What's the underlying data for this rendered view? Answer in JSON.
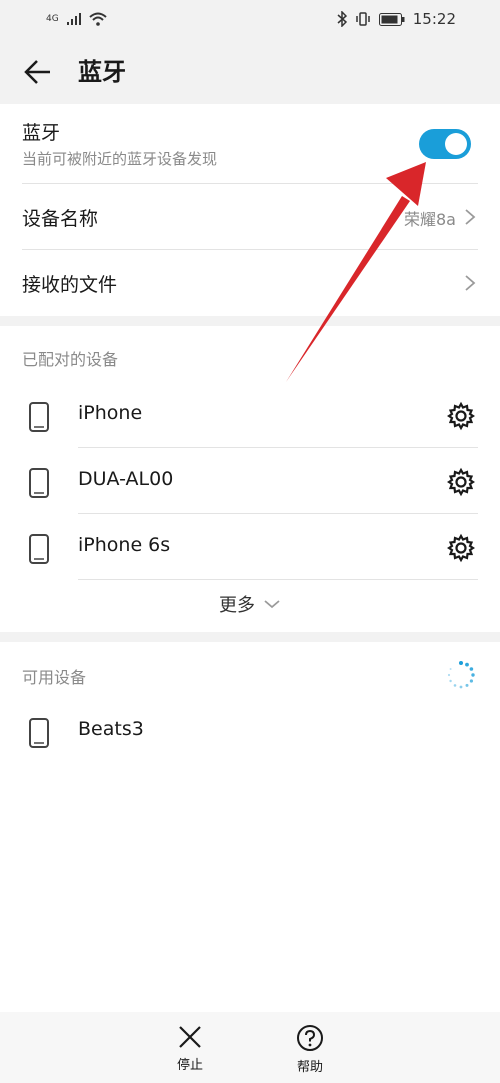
{
  "status_bar": {
    "network": "4G",
    "time": "15:22"
  },
  "app_bar": {
    "title": "蓝牙",
    "back_icon": "arrow-left-icon"
  },
  "bluetooth": {
    "title": "蓝牙",
    "subtitle": "当前可被附近的蓝牙设备发现",
    "enabled": true,
    "accent_color": "#1a9ed9"
  },
  "device_name": {
    "label": "设备名称",
    "value": "荣耀8a"
  },
  "received_files": {
    "label": "接收的文件"
  },
  "paired": {
    "header": "已配对的设备",
    "devices": [
      {
        "name": "iPhone"
      },
      {
        "name": "DUA-AL00"
      },
      {
        "name": "iPhone 6s"
      }
    ],
    "more_label": "更多"
  },
  "available": {
    "header": "可用设备",
    "devices": [
      {
        "name": "Beats3"
      }
    ]
  },
  "bottom_bar": {
    "stop_label": "停止",
    "help_label": "帮助"
  },
  "annotation": {
    "arrow_color": "#d9262a"
  }
}
